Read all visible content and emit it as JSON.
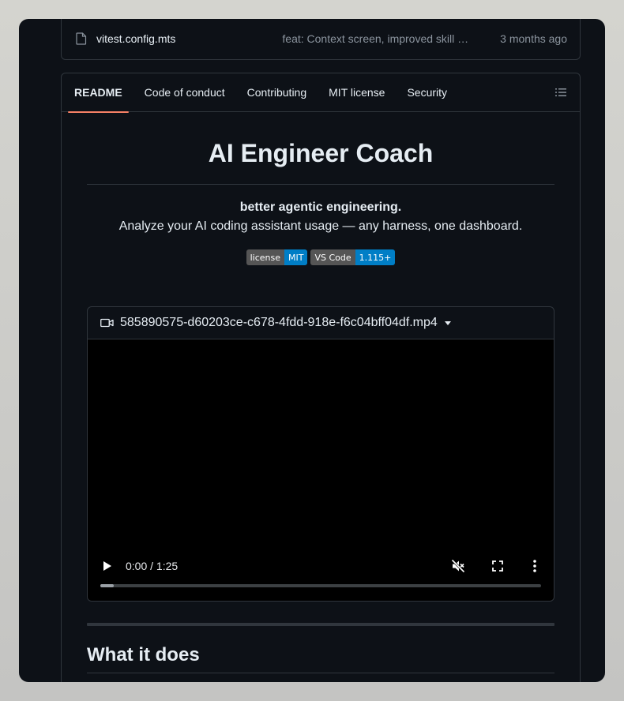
{
  "file": {
    "name": "vitest.config.mts",
    "commit_message": "feat: Context screen, improved skill …",
    "time": "3 months ago"
  },
  "tabs": [
    {
      "label": "README",
      "active": true
    },
    {
      "label": "Code of conduct"
    },
    {
      "label": "Contributing"
    },
    {
      "label": "MIT license"
    },
    {
      "label": "Security"
    }
  ],
  "readme": {
    "title": "AI Engineer Coach",
    "tagline": "better agentic engineering.",
    "subtitle": "Analyze your AI coding assistant usage — any harness, one dashboard.",
    "badges": [
      {
        "left": "license",
        "right": "MIT"
      },
      {
        "left": "VS Code",
        "right": "1.115+"
      }
    ],
    "video": {
      "filename": "585890575-d60203ce-c678-4fdd-918e-f6c04bff04df.mp4",
      "time": "0:00 / 1:25",
      "progress": 0.03
    },
    "section_heading": "What it does"
  },
  "colors": {
    "background": "#0d1117",
    "border": "#30363d",
    "active_tab_underline": "#f78166",
    "badge_left": "#555555",
    "badge_right": "#007ec6"
  }
}
